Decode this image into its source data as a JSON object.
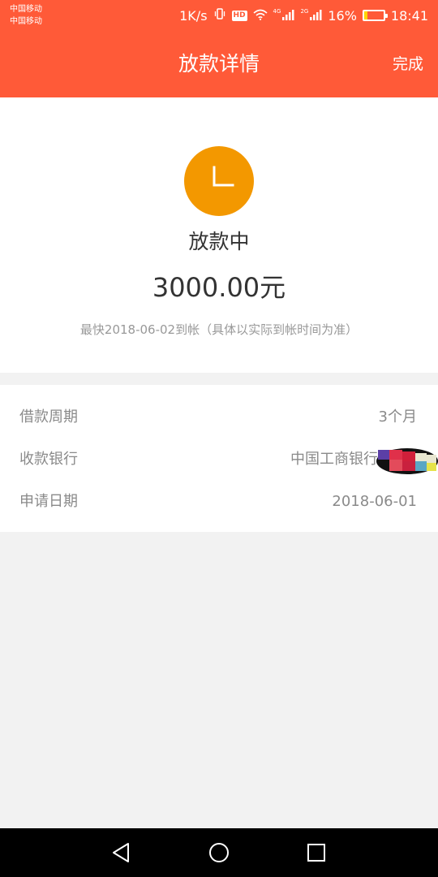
{
  "status_bar": {
    "carrier_1": "中国移动",
    "carrier_2": "中国移动",
    "net_speed": "1K/s",
    "hd_badge": "HD",
    "network_1": "4G",
    "network_2": "2G",
    "battery": "16%",
    "battery_level": 0.16,
    "time": "18:41"
  },
  "header": {
    "title": "放款详情",
    "done_label": "完成",
    "background_color": "#ff5a38"
  },
  "status_card": {
    "icon": "clock-icon",
    "icon_color": "#f39800",
    "status": "放款中",
    "amount": "3000.00元",
    "arrival_note": "最快2018-06-02到帐（具体以实际到帐时间为准）"
  },
  "details": [
    {
      "label": "借款周期",
      "value": "3个月"
    },
    {
      "label": "收款银行",
      "value": "中国工商银行"
    },
    {
      "label": "申请日期",
      "value": "2018-06-01"
    }
  ],
  "nav_bar": {
    "back": "back-triangle-icon",
    "home": "home-circle-icon",
    "recents": "recents-square-icon"
  }
}
